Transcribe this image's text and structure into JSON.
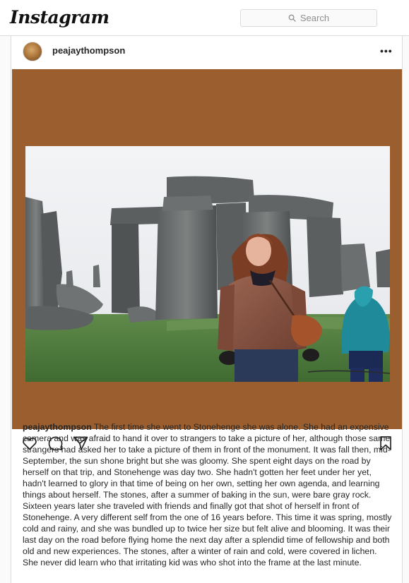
{
  "header": {
    "logo": "Instagram",
    "search_placeholder": "Search"
  },
  "post": {
    "username": "peajaythompson",
    "more_label": "•••",
    "photo_border_color": "#9a5e2f",
    "caption_user": "peajaythompson",
    "caption_text": "The first time she went to Stonehenge she was alone. She had an expensive camera and was afraid to hand it over to strangers to take a picture of her, although those same strangers had asked her to take a picture of them in front of the monument. It was fall then, mid-September, the sun shone bright but she was gloomy. She spent eight days on the road by herself on that trip, and Stonehenge was day two. She hadn't gotten her feet under her yet, hadn't learned to glory in that time of being on her own, setting her own agenda, and learning things about herself. The stones, after a summer of baking in the sun, were bare gray rock. Sixteen years later she traveled with friends and finally got that shot of herself in front of Stonehenge. A very different self from the one of 16 years before. This time it was spring, mostly cold and rainy, and she was bundled up to twice her size but felt alive and blooming. It was their last day on the road before flying home the next day after a splendid time of fellowship and both old and new experiences. The stones, after a winter of rain and cold, were covered in lichen. She never did learn who that irritating kid was who shot into the frame at the last minute."
  }
}
